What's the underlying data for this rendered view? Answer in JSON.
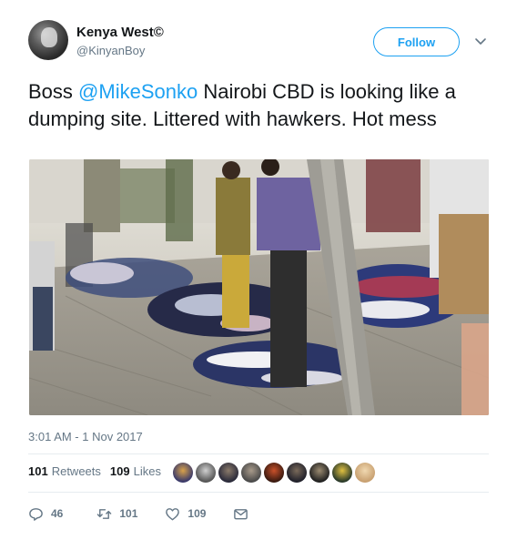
{
  "user": {
    "name": "Kenya West©",
    "handle": "@KinyanBoy"
  },
  "follow": {
    "label": "Follow"
  },
  "tweet": {
    "text_prefix": "Boss ",
    "mention": "@MikeSonko",
    "text_suffix": " Nairobi CBD is looking like a dumping site. Littered with hawkers. Hot mess"
  },
  "timestamp": "3:01 AM - 1 Nov 2017",
  "stats": {
    "retweets_count": "101",
    "retweets_label": "Retweets",
    "likes_count": "109",
    "likes_label": "Likes"
  },
  "actions": {
    "reply_count": "46",
    "retweet_count": "101",
    "like_count": "109"
  },
  "icons": {
    "more": "chevron-down-icon",
    "reply": "reply-icon",
    "retweet": "retweet-icon",
    "like": "heart-icon",
    "message": "direct-message-icon"
  },
  "colors": {
    "accent": "#1da1f2",
    "secondary_text": "#657786",
    "primary_text": "#14171a"
  }
}
